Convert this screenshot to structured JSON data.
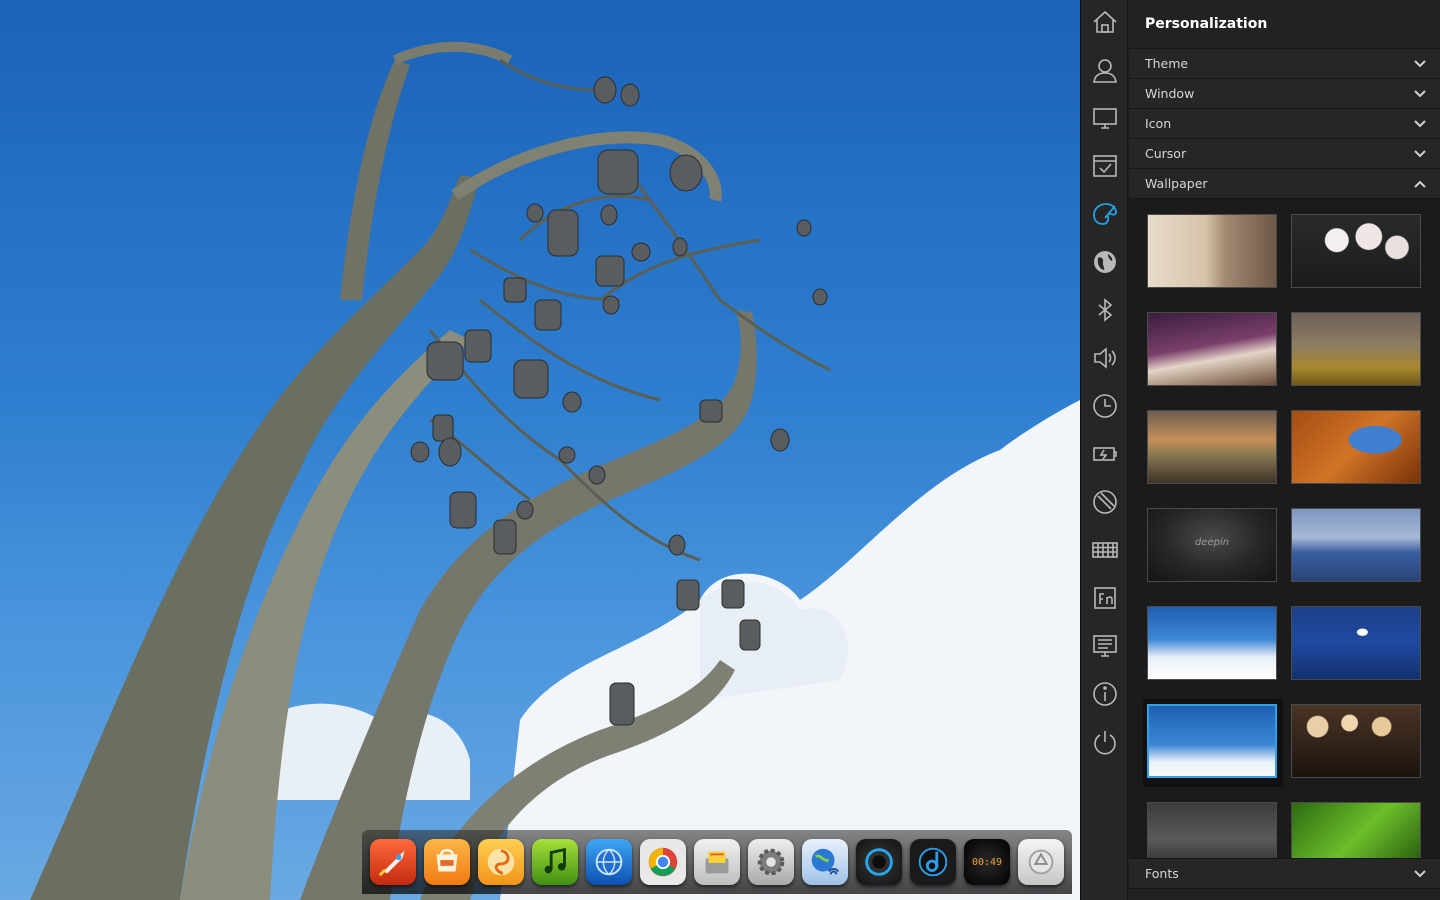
{
  "panel": {
    "title": "Personalization",
    "sections": [
      {
        "label": "Theme",
        "expanded": false
      },
      {
        "label": "Window",
        "expanded": false
      },
      {
        "label": "Icon",
        "expanded": false
      },
      {
        "label": "Cursor",
        "expanded": false
      },
      {
        "label": "Wallpaper",
        "expanded": true
      }
    ],
    "fonts_label": "Fonts",
    "wallpapers": [
      {
        "name": "room-interior"
      },
      {
        "name": "cherry-blossom"
      },
      {
        "name": "bridge-night"
      },
      {
        "name": "golden-grass"
      },
      {
        "name": "paper-boat"
      },
      {
        "name": "rock-arch"
      },
      {
        "name": "deepin-dark",
        "label": "deepin"
      },
      {
        "name": "sea-shore"
      },
      {
        "name": "blue-sky-clouds"
      },
      {
        "name": "seagull-ocean"
      },
      {
        "name": "tree-bells",
        "selected": true
      },
      {
        "name": "lanterns"
      },
      {
        "name": "bw-street"
      },
      {
        "name": "green-leaves"
      }
    ]
  },
  "rail": [
    {
      "icon": "home-icon"
    },
    {
      "icon": "user-icon"
    },
    {
      "icon": "display-icon"
    },
    {
      "icon": "default-apps-icon"
    },
    {
      "icon": "personalization-icon",
      "active": true
    },
    {
      "icon": "network-icon"
    },
    {
      "icon": "bluetooth-icon"
    },
    {
      "icon": "sound-icon"
    },
    {
      "icon": "datetime-icon"
    },
    {
      "icon": "power-icon"
    },
    {
      "icon": "mouse-icon"
    },
    {
      "icon": "keyboard-icon"
    },
    {
      "icon": "shortcuts-icon"
    },
    {
      "icon": "system-info-icon"
    },
    {
      "icon": "about-icon"
    },
    {
      "icon": "shutdown-icon"
    }
  ],
  "dock": {
    "apps": [
      {
        "icon": "launcher-icon"
      },
      {
        "icon": "store-icon"
      },
      {
        "icon": "swirl-app-icon"
      },
      {
        "icon": "music-icon"
      },
      {
        "icon": "browser-globe-icon"
      },
      {
        "icon": "chrome-icon"
      },
      {
        "icon": "file-manager-icon"
      },
      {
        "icon": "settings-icon"
      },
      {
        "icon": "network-globe-icon"
      },
      {
        "icon": "media-player-icon"
      },
      {
        "icon": "deepin-music-icon"
      },
      {
        "icon": "clock-icon",
        "time": "00:49"
      },
      {
        "icon": "trash-icon"
      }
    ]
  },
  "colors": {
    "accent": "#2ea3e8",
    "panel_bg": "#222222",
    "rail_bg": "#262626"
  }
}
